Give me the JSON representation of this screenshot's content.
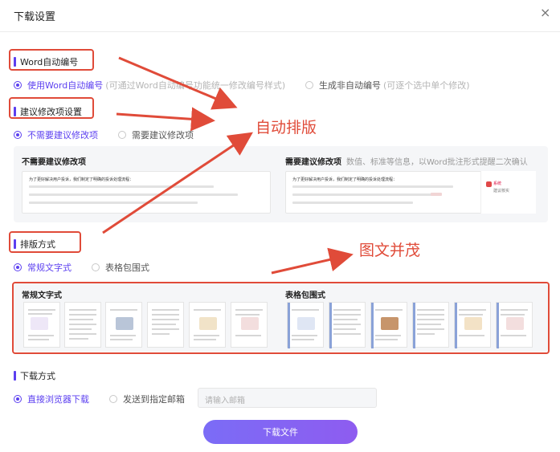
{
  "dialog": {
    "title": "下载设置",
    "close_glyph": "×"
  },
  "sections": {
    "word_numbering": {
      "label": "Word自动编号",
      "option1": "使用Word自动编号",
      "option1_hint": "(可通过Word自动编号功能统一修改编号样式)",
      "option2": "生成非自动编号",
      "option2_hint": "(可逐个选中单个修改)"
    },
    "suggestions": {
      "label": "建议修改项设置",
      "option1": "不需要建议修改项",
      "option2": "需要建议修改项",
      "preview_left_title": "不需要建议修改项",
      "preview_right_title": "需要建议修改项",
      "preview_right_hint": "数值、标准等信息，以Word批注形式提醒二次确认",
      "doc_heading": "为了更好解决用户投诉，我们制定了明确的投诉处理流程：",
      "comment_author": "系统",
      "comment_text": "建议核实"
    },
    "layout": {
      "label": "排版方式",
      "option1": "常规文字式",
      "option2": "表格包围式",
      "preview_left_title": "常规文字式",
      "preview_right_title": "表格包围式"
    },
    "download": {
      "label": "下载方式",
      "option1": "直接浏览器下载",
      "option2": "发送到指定邮箱",
      "email_placeholder": "请输入邮箱"
    }
  },
  "button": {
    "download": "下载文件"
  },
  "annotations": {
    "auto_layout": "自动排版",
    "image_text": "图文并茂"
  },
  "colors": {
    "accent": "#5b3ff0",
    "annotation_red": "#e04b39",
    "button_start": "#7b6cf6",
    "button_end": "#8e5cf0"
  }
}
